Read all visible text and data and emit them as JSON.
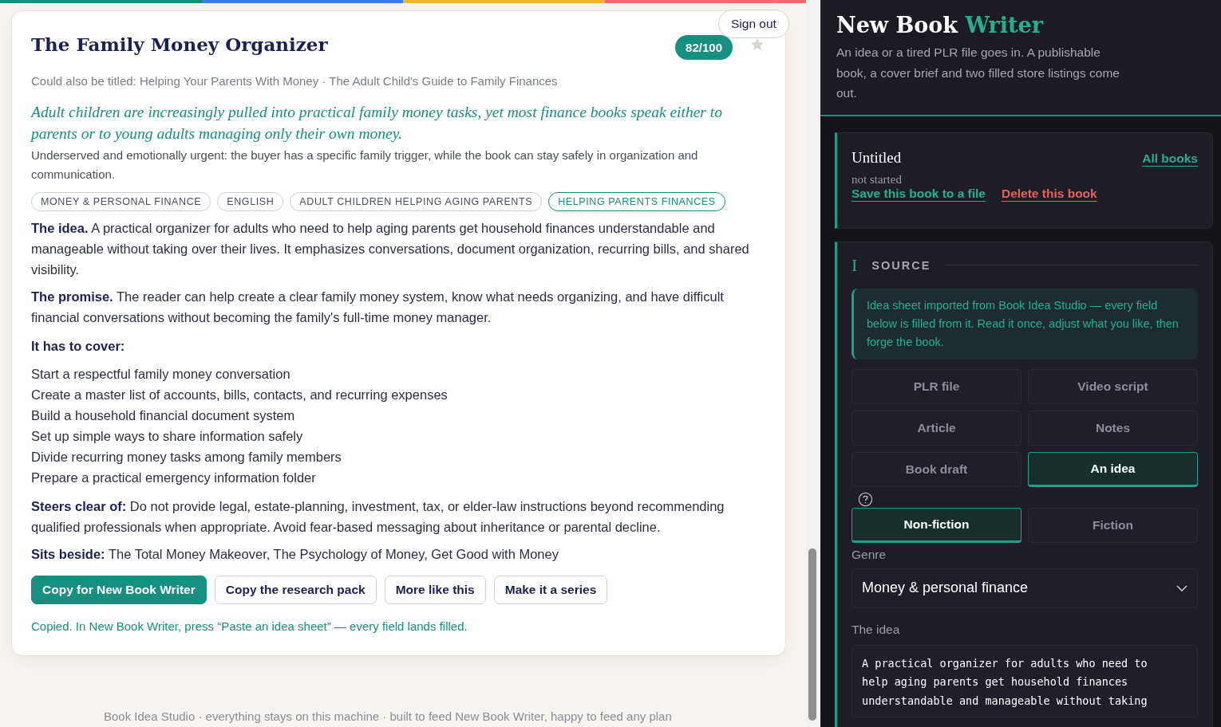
{
  "idea_card": {
    "title": "The Family Money Organizer",
    "score": "82/100",
    "starred": false,
    "alt_titles": "Could also be titled: Helping Your Parents With Money · The Adult Child's Guide to Family Finances",
    "hook": "Adult children are increasingly pulled into practical family money tasks, yet most finance books speak either to parents or to young adults managing only their own money.",
    "why": "Underserved and emotionally urgent: the buyer has a specific family trigger, while the book can stay safely in organization and communication.",
    "tags": [
      {
        "label": "MONEY & PERSONAL FINANCE",
        "highlighted": false
      },
      {
        "label": "ENGLISH",
        "highlighted": false
      },
      {
        "label": "ADULT CHILDREN HELPING AGING PARENTS",
        "highlighted": false
      },
      {
        "label": "HELPING PARENTS FINANCES",
        "highlighted": true
      }
    ],
    "idea": "**The idea.** A practical organizer for adults who need to help aging parents get household finances understandable and manageable without taking over their lives. It emphasizes conversations, document organization, recurring bills, and shared visibility.",
    "promise": "**The promise.** The reader can help create a clear family money system, know what needs organizing, and have difficult financial conversations without becoming the family's full-time money manager.",
    "cover_heading": "It has to cover:",
    "cover_items": [
      "Start a respectful family money conversation",
      "Create a master list of accounts, bills, contacts, and recurring expenses",
      "Build a household financial document system",
      "Set up simple ways to share information safely",
      "Divide recurring money tasks among family members",
      "Prepare a practical emergency information folder"
    ],
    "steers_clear": "**Steers clear of:** Do not provide legal, estate-planning, investment, tax, or elder-law instructions beyond recommending qualified professionals when appropriate. Avoid fear-based messaging about inheritance or parental decline.",
    "sits_beside": "**Sits beside:** The Total Money Makeover, The Psychology of Money, Get Good with Money",
    "buttons": [
      {
        "label": "Copy for New Book Writer",
        "primary": true
      },
      {
        "label": "Copy the research pack",
        "primary": false
      },
      {
        "label": "More like this",
        "primary": false
      },
      {
        "label": "Make it a series",
        "primary": false
      }
    ],
    "status": "Copied. In New Book Writer, press “Paste an idea sheet” — every field lands filled."
  },
  "sign_out": "Sign out",
  "footer": "Book Idea Studio · everything stays on this machine · built to feed New Book Writer, happy to feed any plan",
  "writer": {
    "title": "New Book",
    "title_accent": "Writer",
    "tagline": "An idea or a tired PLR file goes in. A publishable book, a cover brief and two filled store listings come out.",
    "book": {
      "name": "Untitled",
      "state": "not started",
      "all_books": "All books",
      "save": "Save this book to a file",
      "delete": "Delete this book"
    },
    "source": {
      "numeral": "I",
      "heading": "SOURCE",
      "notice": "Idea sheet imported from Book Idea Studio — every field below is filled from it. Read it once, adjust what you like, then forge the book.",
      "types": [
        {
          "label": "PLR file",
          "selected": false
        },
        {
          "label": "Video script",
          "selected": false
        },
        {
          "label": "Article",
          "selected": false
        },
        {
          "label": "Notes",
          "selected": false
        },
        {
          "label": "Book draft",
          "selected": false
        },
        {
          "label": "An idea",
          "selected": true
        }
      ],
      "kinds": [
        {
          "label": "Non-fiction",
          "selected": true
        },
        {
          "label": "Fiction",
          "selected": false
        }
      ],
      "genre_label": "Genre",
      "genre": "Money & personal finance",
      "idea_label": "The idea",
      "idea_value": "A practical organizer for adults who need to help aging parents get household finances understandable and manageable without taking"
    }
  }
}
